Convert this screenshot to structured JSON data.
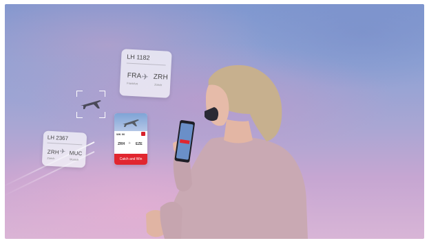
{
  "cards": [
    {
      "flight": "LH 1182",
      "from": "FRA",
      "from_city": "Frankfurt",
      "to": "ZRH",
      "to_city": "Zürich"
    },
    {
      "flight": "LH 2367",
      "from": "ZRH",
      "from_city": "Zürich",
      "to": "MUC",
      "to_city": "Munich"
    }
  ],
  "offer": {
    "flight": "WK 90",
    "from": "ZRH",
    "to": "EZE",
    "cta": "Catch and Win"
  },
  "icons": {
    "plane": "airplane-icon",
    "brand": "airline-logo-icon",
    "scan": "scan-brackets-icon"
  },
  "colors": {
    "sky_top": "#7f97cf",
    "sky_bottom": "#d8b5d6",
    "accent_red": "#e1262f",
    "sweater": "#c9a9b3",
    "hair": "#c7b08e"
  }
}
